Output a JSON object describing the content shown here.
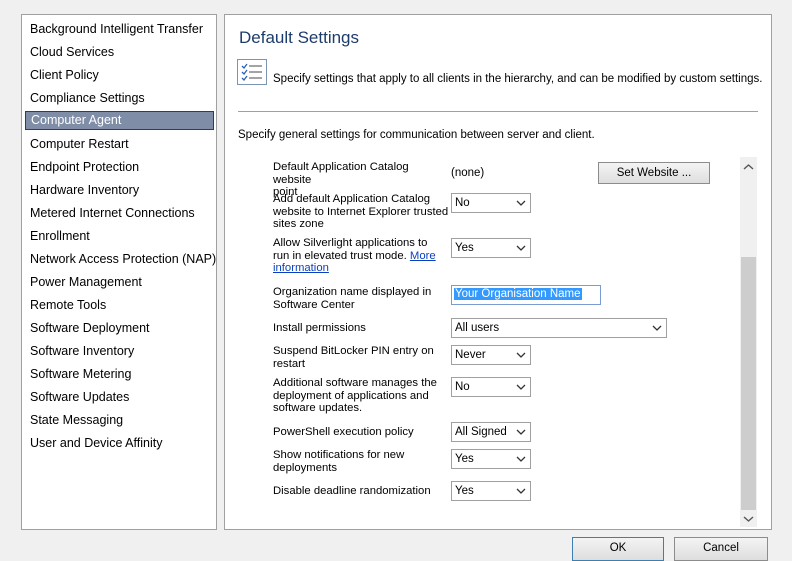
{
  "nav": {
    "items": [
      "Background Intelligent Transfer",
      "Cloud Services",
      "Client Policy",
      "Compliance Settings",
      "Computer Agent",
      "Computer Restart",
      "Endpoint Protection",
      "Hardware Inventory",
      "Metered Internet Connections",
      "Enrollment",
      "Network Access Protection (NAP)",
      "Power Management",
      "Remote Tools",
      "Software Deployment",
      "Software Inventory",
      "Software Metering",
      "Software Updates",
      "State Messaging",
      "User and Device Affinity"
    ],
    "selected": "Computer Agent"
  },
  "panel": {
    "title": "Default Settings",
    "description": "Specify settings that apply to all clients in the hierarchy, and can be modified by custom settings.",
    "icon": "checklist-icon",
    "subdescription": "Specify general settings for communication between server and client."
  },
  "settings": {
    "catalog_point": {
      "label_1": "Default Application Catalog website",
      "label_2": "point",
      "value": "(none)",
      "button": "Set Website ..."
    },
    "add_to_ie": {
      "label_1": "Add default Application Catalog",
      "label_2": "website to Internet Explorer trusted",
      "label_3": "sites zone",
      "value": "No"
    },
    "silverlight": {
      "label_1": "Allow Silverlight applications to",
      "label_2": "run in elevated trust mode.",
      "link_1": "More",
      "link_2": "information",
      "value": "Yes"
    },
    "org_name": {
      "label_1": "Organization name displayed in",
      "label_2": "Software Center",
      "value": "Your Organisation Name"
    },
    "install_permissions": {
      "label": "Install permissions",
      "value": "All users"
    },
    "bitlocker": {
      "label_1": "Suspend BitLocker PIN entry on",
      "label_2": "restart",
      "value": "Never"
    },
    "additional_software": {
      "label_1": "Additional software manages the",
      "label_2": "deployment of applications and",
      "label_3": "software updates.",
      "value": "No"
    },
    "powershell": {
      "label": "PowerShell execution policy",
      "value": "All Signed"
    },
    "notifications": {
      "label_1": "Show notifications for new",
      "label_2": "deployments",
      "value": "Yes"
    },
    "deadline": {
      "label": "Disable deadline randomization",
      "value": "Yes"
    }
  },
  "footer": {
    "ok": "OK",
    "cancel": "Cancel"
  },
  "colors": {
    "selection": "#7f8ea6",
    "title": "#1e3c6b",
    "link": "#0a3fbf",
    "highlight": "#3399ff"
  }
}
